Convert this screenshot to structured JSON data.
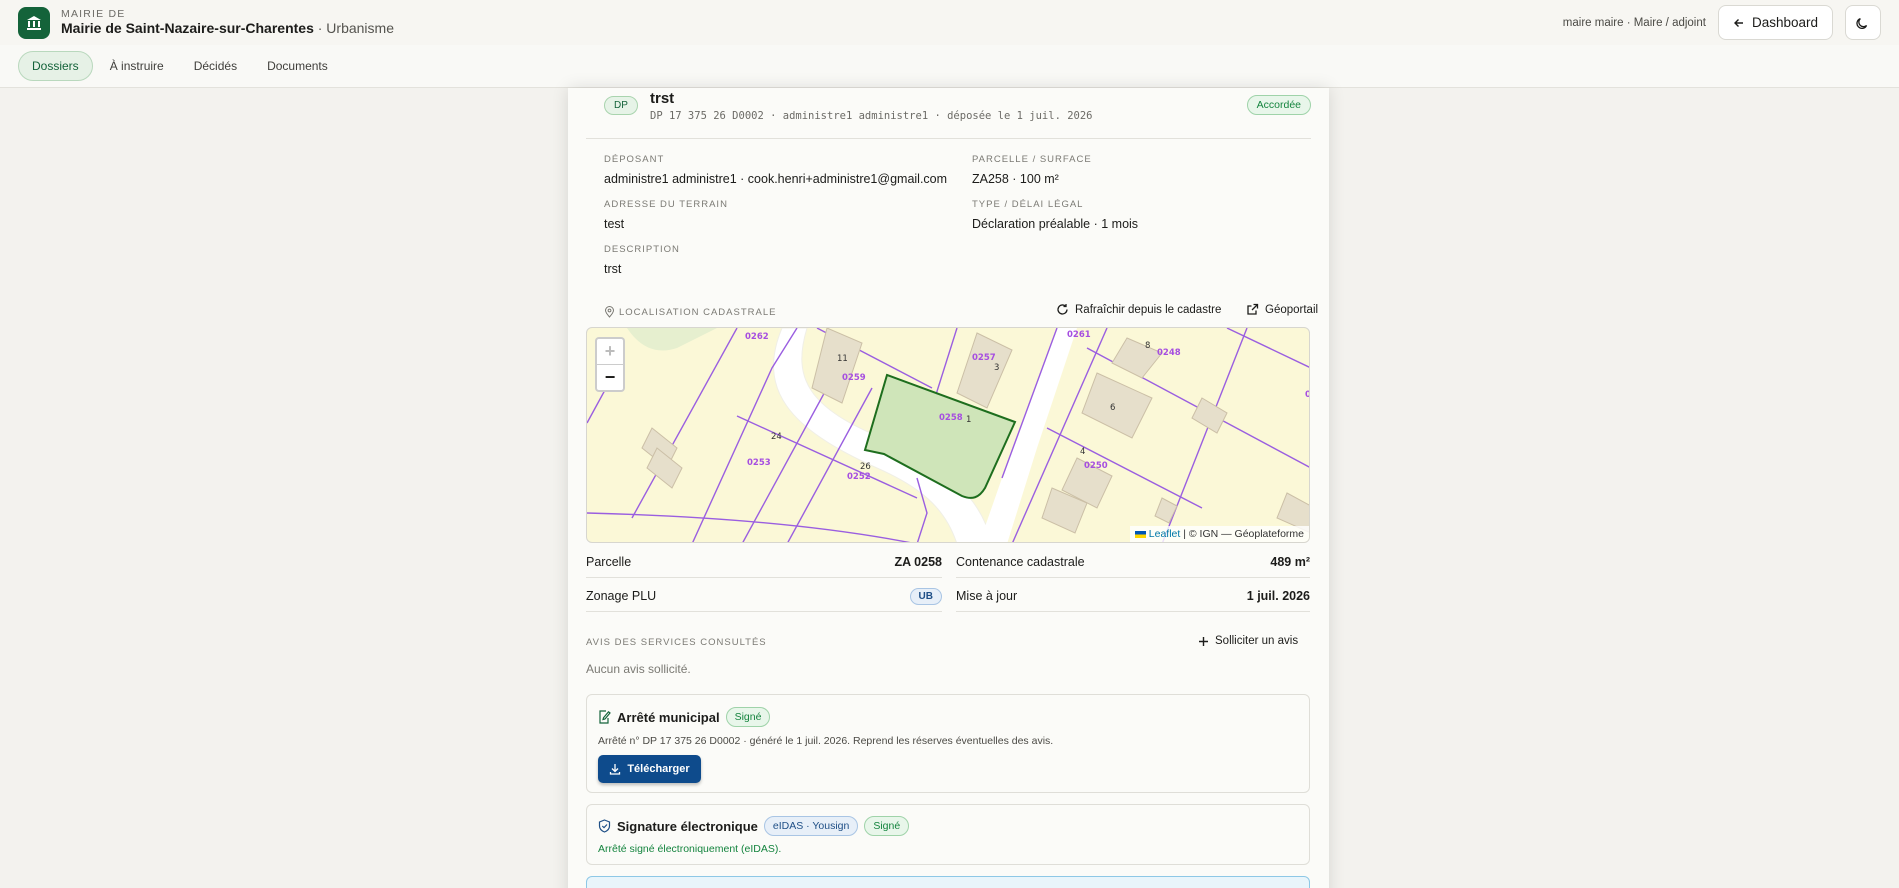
{
  "header": {
    "kicker": "MAIRIE DE",
    "title": "Mairie de Saint-Nazaire-sur-Charentes",
    "subtitle": " · Urbanisme",
    "user": "maire maire · Maire / adjoint",
    "dashboard_label": "Dashboard",
    "logo_icon": "town-hall-icon",
    "theme_icon": "moon-icon"
  },
  "nav": {
    "tabs": [
      {
        "label": "Dossiers",
        "active": true
      },
      {
        "label": "À instruire"
      },
      {
        "label": "Décidés"
      },
      {
        "label": "Documents"
      }
    ]
  },
  "dossier": {
    "type_badge": "DP",
    "title": "trst",
    "meta": "DP 17 375 26 D0002 · administre1 administre1 · déposée le 1 juil. 2026",
    "status": "Accordée",
    "fields": {
      "deposant_label": "DÉPOSANT",
      "deposant_value": "administre1 administre1 · cook.henri+administre1@gmail.com",
      "parcelle_label": "PARCELLE / SURFACE",
      "parcelle_value": "ZA258 · 100 m²",
      "adresse_label": "ADRESSE DU TERRAIN",
      "adresse_value": "test",
      "type_label": "TYPE / DÉLAI LÉGAL",
      "type_value": "Déclaration préalable · 1 mois",
      "description_label": "DESCRIPTION",
      "description_value": "trst"
    }
  },
  "localisation": {
    "label": "LOCALISATION CADASTRALE",
    "refresh_label": "Rafraîchir depuis le cadastre",
    "geoportail_label": "Géoportail",
    "map": {
      "zoom_in": "+",
      "zoom_out": "−",
      "attribution_link": "Leaflet",
      "attribution_text": " | © IGN — Géoplateforme",
      "parcel_labels": [
        "0262",
        "0259",
        "0257",
        "0261",
        "0248",
        "0258",
        "0253",
        "0252",
        "0250",
        "0"
      ],
      "house_numbers": [
        "11",
        "3",
        "8",
        "6",
        "24",
        "26",
        "1",
        "4"
      ]
    }
  },
  "cadastre": {
    "parcelle_label": "Parcelle",
    "parcelle_value": "ZA 0258",
    "contenance_label": "Contenance cadastrale",
    "contenance_value": "489 m²",
    "zonage_label": "Zonage PLU",
    "zonage_value": "UB",
    "maj_label": "Mise à jour",
    "maj_value": "1 juil. 2026"
  },
  "avis": {
    "label": "AVIS DES SERVICES CONSULTÉS",
    "solliciter_label": "Solliciter un avis",
    "empty": "Aucun avis sollicité."
  },
  "arrete": {
    "title": "Arrêté municipal",
    "status": "Signé",
    "text": "Arrêté n° DP 17 375 26 D0002 · généré le 1 juil. 2026. Reprend les réserves éventuelles des avis.",
    "download_label": "Télécharger"
  },
  "signature": {
    "title": "Signature électronique",
    "provider": "eIDAS · Yousign",
    "status": "Signé",
    "text": "Arrêté signé électroniquement (eIDAS)."
  },
  "colors": {
    "brand": "#14633a",
    "primary_button": "#0e4b8c",
    "success": "#14843e"
  }
}
